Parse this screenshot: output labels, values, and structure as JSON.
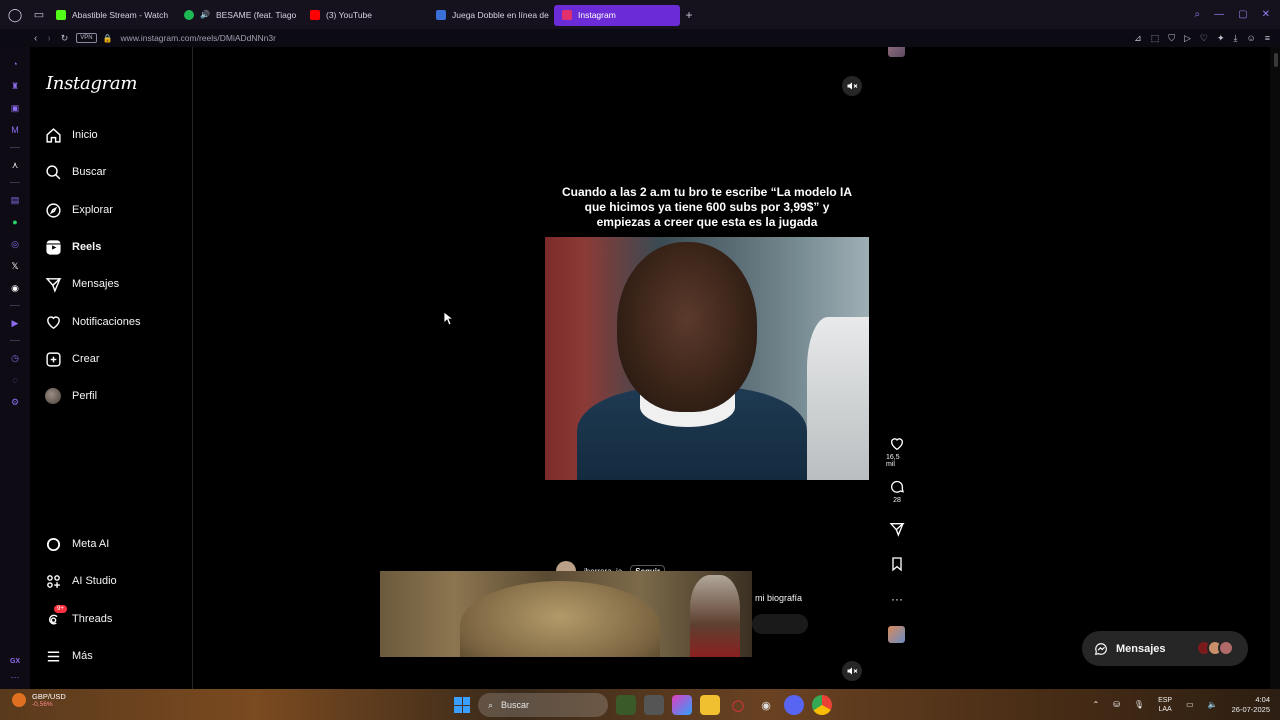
{
  "browser": {
    "tabs": [
      {
        "label": "Abastible Stream - Watch",
        "favicon_color": "#53fc18",
        "active": false
      },
      {
        "label": "BESAME (feat. Tiago",
        "favicon_color": "#1db954",
        "active": false
      },
      {
        "label": "(3) YouTube",
        "favicon_color": "#ff0000",
        "active": false
      },
      {
        "label": "Juega Dobble en línea de",
        "favicon_color": "#3a6fd8",
        "active": false
      },
      {
        "label": "Instagram",
        "favicon_color": "#e1306c",
        "active": true
      }
    ],
    "vpn_label": "VPN",
    "url": "www.instagram.com/reels/DMiADdNNn3r"
  },
  "instagram": {
    "logo": "Instagram",
    "nav": {
      "inicio": "Inicio",
      "buscar": "Buscar",
      "explorar": "Explorar",
      "reels": "Reels",
      "mensajes": "Mensajes",
      "notificaciones": "Notificaciones",
      "crear": "Crear",
      "perfil": "Perfil",
      "meta_ai": "Meta AI",
      "ai_studio": "AI Studio",
      "threads": "Threads",
      "threads_badge": "9+",
      "mas": "Más"
    },
    "reel": {
      "caption_line1": "Cuando a las 2 a.m tu bro te escribe “La modelo IA",
      "caption_line2": "que hicimos ya tiene 600 subs por 3,99$” y",
      "caption_line3": "empiezas a creer que esta es la jugada",
      "likes": "16,5 mil",
      "comments": "28",
      "author": "jherrera_ia",
      "follow": "Seguir",
      "bio_link": "mi biografía"
    },
    "messages_pill": "Mensajes"
  },
  "taskbar": {
    "stock_symbol": "GBP/USD",
    "stock_change": "-0,56%",
    "search": "Buscar",
    "lang_top": "ESP",
    "lang_bottom": "LAA",
    "time": "4:04",
    "date": "26-07-2025"
  },
  "colors": {
    "opera_accent": "#6b2bd6",
    "instagram_bg": "#000000",
    "notification_badge": "#ff3040"
  }
}
